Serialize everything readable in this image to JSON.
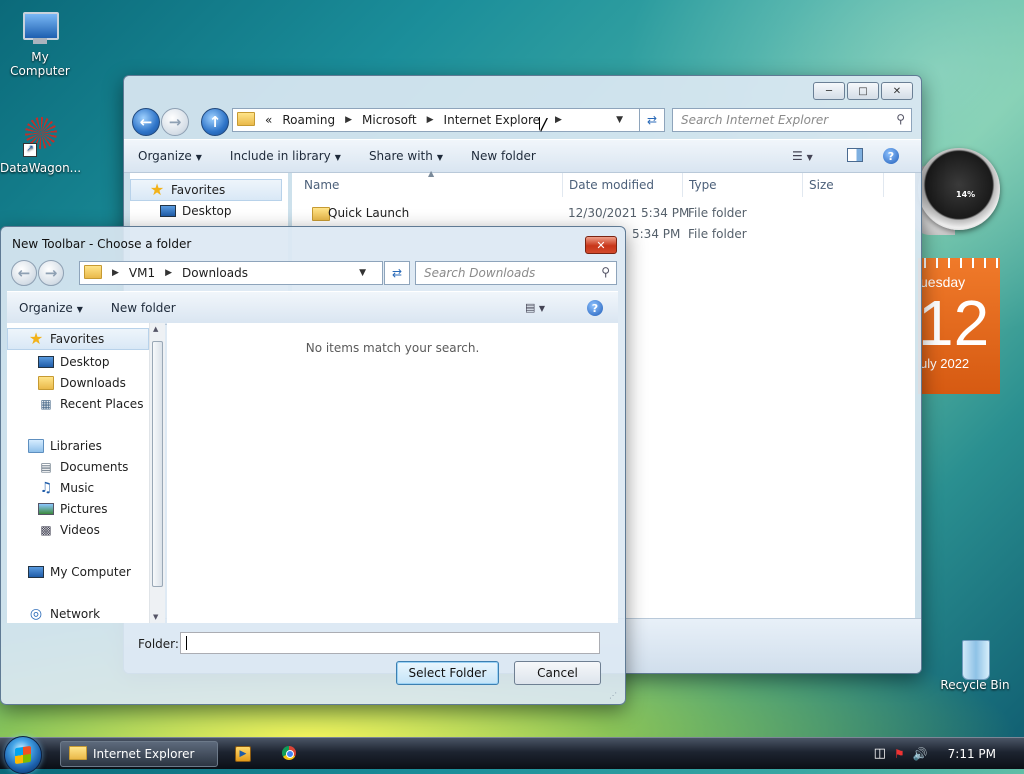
{
  "desktop": {
    "icons": [
      {
        "label": "My Computer"
      },
      {
        "label": "DataWagon..."
      },
      {
        "label": "Recycle Bin"
      }
    ],
    "gadgets": {
      "cpu_percent": "14%",
      "calendar": {
        "weekday": "uesday",
        "day": "12",
        "month_year": "uly 2022"
      }
    }
  },
  "explorer": {
    "breadcrumb": [
      "«",
      "Roaming",
      "Microsoft",
      "Internet Explorer"
    ],
    "search_placeholder": "Search Internet Explorer",
    "commands": [
      "Organize",
      "Include in library",
      "Share with",
      "New folder"
    ],
    "nav": {
      "favorites": "Favorites",
      "desktop": "Desktop"
    },
    "columns": [
      "Name",
      "Date modified",
      "Type",
      "Size"
    ],
    "rows": [
      {
        "name": "Quick Launch",
        "date": "12/30/2021 5:34 PM",
        "type": "File folder",
        "size": ""
      },
      {
        "name": "",
        "date": "5:34 PM",
        "type": "File folder",
        "size": ""
      }
    ]
  },
  "dialog": {
    "title": "New Toolbar - Choose a folder",
    "breadcrumb": [
      "VM1",
      "Downloads"
    ],
    "search_placeholder": "Search Downloads",
    "commands": [
      "Organize",
      "New folder"
    ],
    "nav": {
      "favorites": "Favorites",
      "favorites_items": [
        "Desktop",
        "Downloads",
        "Recent Places"
      ],
      "libraries": "Libraries",
      "libraries_items": [
        "Documents",
        "Music",
        "Pictures",
        "Videos"
      ],
      "computer": "My Computer",
      "network": "Network"
    },
    "empty_text": "No items match your search.",
    "folder_label": "Folder:",
    "folder_value": "",
    "select_button": "Select Folder",
    "cancel_button": "Cancel"
  },
  "taskbar": {
    "task_label": "Internet Explorer",
    "time": "7:11 PM"
  }
}
